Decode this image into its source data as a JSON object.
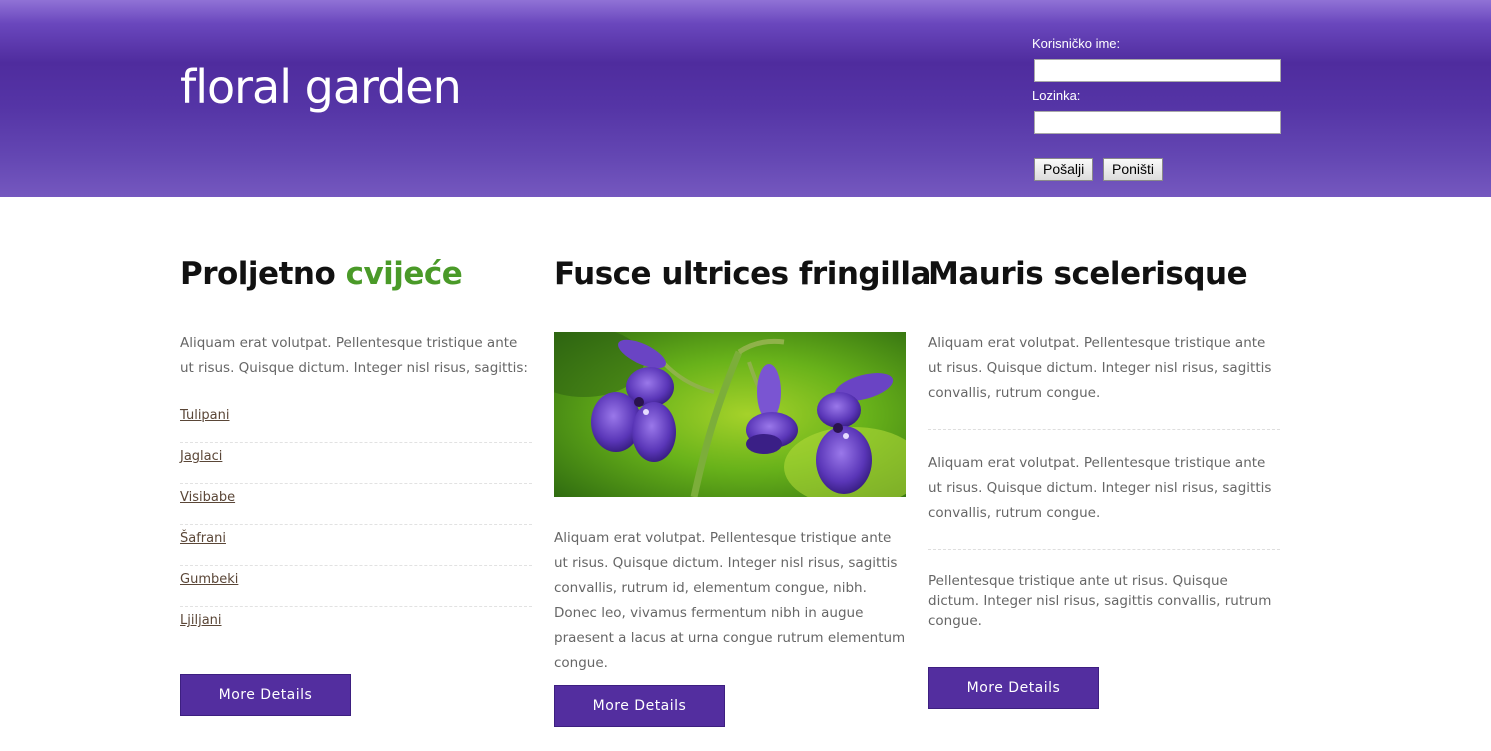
{
  "header": {
    "logo": "floral garden",
    "login": {
      "username_label": "Korisničko ime:",
      "password_label": "Lozinka:",
      "username_value": "",
      "password_value": "",
      "submit_label": "Pošalji",
      "reset_label": "Poništi"
    }
  },
  "columns": [
    {
      "title_main": "Proljetno ",
      "title_accent": "cvijeće",
      "intro": "Aliquam erat volutpat. Pellentesque tristique ante ut risus. Quisque dictum. Integer nisl risus, sagittis:",
      "items": [
        "Tulipani",
        "Jaglaci",
        "Visibabe",
        "Šafrani",
        "Gumbeki",
        "Ljiljani"
      ],
      "button": "More Details"
    },
    {
      "title": "Fusce ultrices fringilla",
      "image": "purple-flowers-photo",
      "text": "Aliquam erat volutpat. Pellentesque tristique ante ut risus. Quisque dictum. Integer nisl risus, sagittis convallis, rutrum id, elementum congue, nibh. Donec leo, vivamus fermentum nibh in augue praesent a lacus at urna congue rutrum elementum congue.",
      "button": "More Details"
    },
    {
      "title": "Mauris scelerisque",
      "paragraphs": [
        "Aliquam erat volutpat. Pellentesque tristique ante ut risus. Quisque dictum. Integer nisl risus, sagittis convallis, rutrum congue.",
        "Aliquam erat volutpat. Pellentesque tristique ante ut risus. Quisque dictum. Integer nisl risus, sagittis convallis, rutrum congue.",
        "Pellentesque tristique ante ut risus. Quisque dictum. Integer nisl risus, sagittis convallis, rutrum congue."
      ],
      "button": "More Details"
    }
  ],
  "colors": {
    "header_purple": "#5535a6",
    "button_purple": "#532e9f",
    "accent_green": "#4a9a28",
    "link_brown": "#5a4637",
    "body_text": "#666666"
  }
}
